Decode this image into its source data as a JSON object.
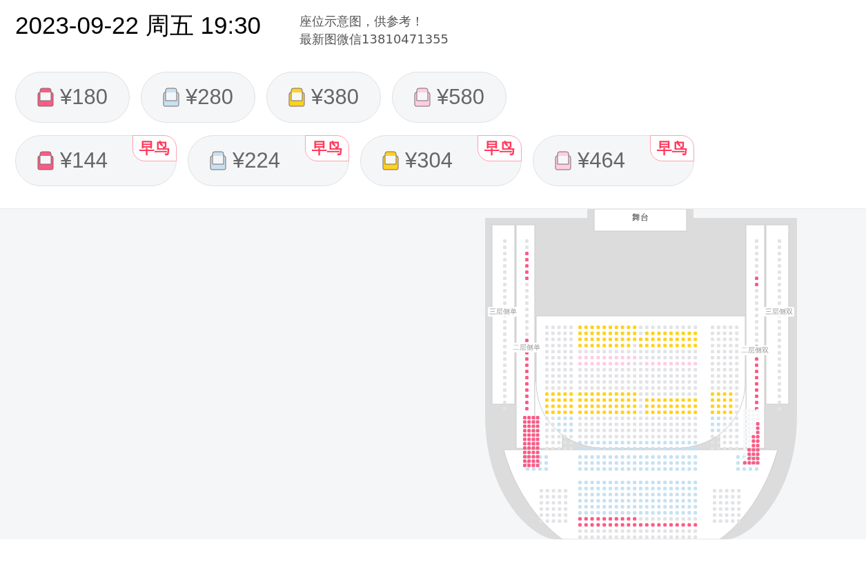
{
  "header": {
    "datetime": "2023-09-22 周五 19:30",
    "notice_lines": [
      "座位示意图，供参考！",
      "最新图微信13810471355"
    ]
  },
  "price_rows": [
    [
      {
        "price": "¥180",
        "color": "#fb5b85",
        "early_bird": false
      },
      {
        "price": "¥280",
        "color": "#c6e1f2",
        "early_bird": false
      },
      {
        "price": "¥380",
        "color": "#ffd21e",
        "early_bird": false
      },
      {
        "price": "¥580",
        "color": "#ffcde3",
        "early_bird": false
      }
    ],
    [
      {
        "price": "¥144",
        "color": "#fb5b85",
        "early_bird": true,
        "badge": "早鸟"
      },
      {
        "price": "¥224",
        "color": "#c6e1f2",
        "early_bird": true,
        "badge": "早鸟"
      },
      {
        "price": "¥304",
        "color": "#ffd21e",
        "early_bird": true,
        "badge": "早鸟"
      },
      {
        "price": "¥464",
        "color": "#ffcde3",
        "early_bird": true,
        "badge": "早鸟"
      }
    ]
  ],
  "seat_map": {
    "stage": "舞台",
    "section_labels": [
      "三层侧单",
      "二层侧单",
      "三层侧双",
      "二层侧双"
    ]
  }
}
